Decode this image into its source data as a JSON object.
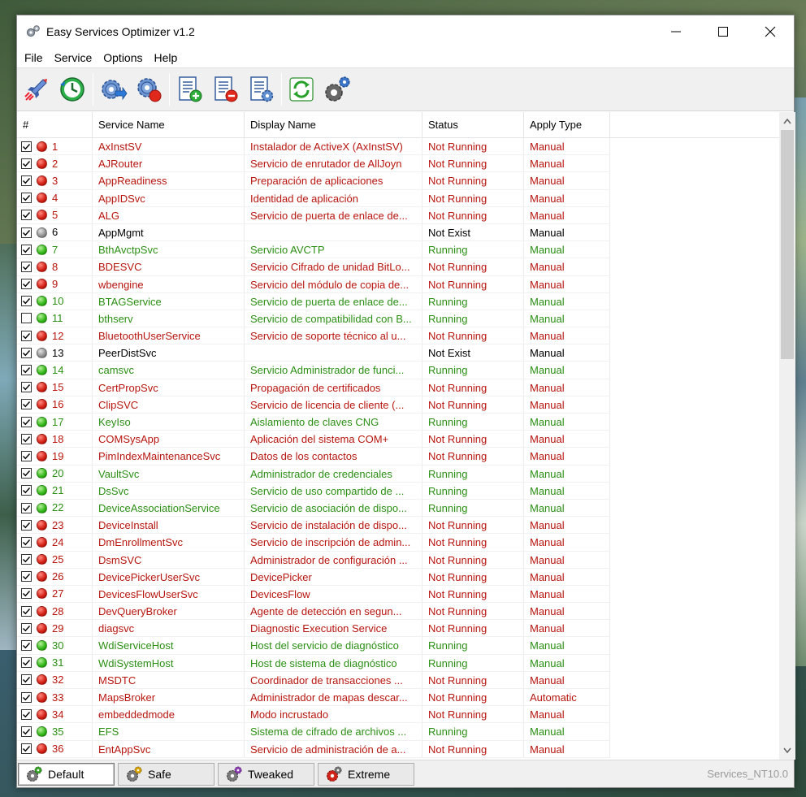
{
  "window": {
    "title": "Easy Services Optimizer v1.2"
  },
  "menu": [
    "File",
    "Service",
    "Options",
    "Help"
  ],
  "toolbar": [
    {
      "icon": "rocket-optimize-icon"
    },
    {
      "icon": "clock-restore-icon"
    },
    {
      "icon": "gear-arrow-icon"
    },
    {
      "icon": "gear-stop-icon"
    },
    {
      "icon": "list-add-icon"
    },
    {
      "icon": "list-remove-icon"
    },
    {
      "icon": "list-settings-icon"
    },
    {
      "icon": "refresh-icon"
    },
    {
      "icon": "gears-icon"
    }
  ],
  "table": {
    "headers": {
      "num": "#",
      "service": "Service Name",
      "display": "Display Name",
      "status": "Status",
      "type": "Apply Type"
    },
    "rows": [
      {
        "num": "1",
        "checked": true,
        "state": "red",
        "service": "AxInstSV",
        "display": "Instalador de ActiveX (AxInstSV)",
        "status": "Not Running",
        "type": "Manual"
      },
      {
        "num": "2",
        "checked": true,
        "state": "red",
        "service": "AJRouter",
        "display": "Servicio de enrutador de AllJoyn",
        "status": "Not Running",
        "type": "Manual"
      },
      {
        "num": "3",
        "checked": true,
        "state": "red",
        "service": "AppReadiness",
        "display": "Preparación de aplicaciones",
        "status": "Not Running",
        "type": "Manual"
      },
      {
        "num": "4",
        "checked": true,
        "state": "red",
        "service": "AppIDSvc",
        "display": "Identidad de aplicación",
        "status": "Not Running",
        "type": "Manual"
      },
      {
        "num": "5",
        "checked": true,
        "state": "red",
        "service": "ALG",
        "display": "Servicio de puerta de enlace de...",
        "status": "Not Running",
        "type": "Manual"
      },
      {
        "num": "6",
        "checked": true,
        "state": "gray",
        "service": "AppMgmt",
        "display": "",
        "status": "Not Exist",
        "type": "Manual"
      },
      {
        "num": "7",
        "checked": true,
        "state": "green",
        "service": "BthAvctpSvc",
        "display": "Servicio AVCTP",
        "status": "Running",
        "type": "Manual"
      },
      {
        "num": "8",
        "checked": true,
        "state": "red",
        "service": "BDESVC",
        "display": "Servicio Cifrado de unidad BitLo...",
        "status": "Not Running",
        "type": "Manual"
      },
      {
        "num": "9",
        "checked": true,
        "state": "red",
        "service": "wbengine",
        "display": "Servicio del módulo de copia de...",
        "status": "Not Running",
        "type": "Manual"
      },
      {
        "num": "10",
        "checked": true,
        "state": "green",
        "service": "BTAGService",
        "display": "Servicio de puerta de enlace de...",
        "status": "Running",
        "type": "Manual"
      },
      {
        "num": "11",
        "checked": false,
        "state": "green",
        "service": "bthserv",
        "display": "Servicio de compatibilidad con B...",
        "status": "Running",
        "type": "Manual"
      },
      {
        "num": "12",
        "checked": true,
        "state": "red",
        "service": "BluetoothUserService",
        "display": "Servicio de soporte técnico al u...",
        "status": "Not Running",
        "type": "Manual"
      },
      {
        "num": "13",
        "checked": true,
        "state": "gray",
        "service": "PeerDistSvc",
        "display": "",
        "status": "Not Exist",
        "type": "Manual"
      },
      {
        "num": "14",
        "checked": true,
        "state": "green",
        "service": "camsvc",
        "display": "Servicio Administrador de funci...",
        "status": "Running",
        "type": "Manual"
      },
      {
        "num": "15",
        "checked": true,
        "state": "red",
        "service": "CertPropSvc",
        "display": "Propagación de certificados",
        "status": "Not Running",
        "type": "Manual"
      },
      {
        "num": "16",
        "checked": true,
        "state": "red",
        "service": "ClipSVC",
        "display": "Servicio de licencia de cliente (...",
        "status": "Not Running",
        "type": "Manual"
      },
      {
        "num": "17",
        "checked": true,
        "state": "green",
        "service": "KeyIso",
        "display": "Aislamiento de claves CNG",
        "status": "Running",
        "type": "Manual"
      },
      {
        "num": "18",
        "checked": true,
        "state": "red",
        "service": "COMSysApp",
        "display": "Aplicación del sistema COM+",
        "status": "Not Running",
        "type": "Manual"
      },
      {
        "num": "19",
        "checked": true,
        "state": "red",
        "service": "PimIndexMaintenanceSvc",
        "display": "Datos de los contactos",
        "status": "Not Running",
        "type": "Manual"
      },
      {
        "num": "20",
        "checked": true,
        "state": "green",
        "service": "VaultSvc",
        "display": "Administrador de credenciales",
        "status": "Running",
        "type": "Manual"
      },
      {
        "num": "21",
        "checked": true,
        "state": "green",
        "service": "DsSvc",
        "display": "Servicio de uso compartido de ...",
        "status": "Running",
        "type": "Manual"
      },
      {
        "num": "22",
        "checked": true,
        "state": "green",
        "service": "DeviceAssociationService",
        "display": "Servicio de asociación de dispo...",
        "status": "Running",
        "type": "Manual"
      },
      {
        "num": "23",
        "checked": true,
        "state": "red",
        "service": "DeviceInstall",
        "display": "Servicio de instalación de dispo...",
        "status": "Not Running",
        "type": "Manual"
      },
      {
        "num": "24",
        "checked": true,
        "state": "red",
        "service": "DmEnrollmentSvc",
        "display": "Servicio de inscripción de admin...",
        "status": "Not Running",
        "type": "Manual"
      },
      {
        "num": "25",
        "checked": true,
        "state": "red",
        "service": "DsmSVC",
        "display": "Administrador de configuración ...",
        "status": "Not Running",
        "type": "Manual"
      },
      {
        "num": "26",
        "checked": true,
        "state": "red",
        "service": "DevicePickerUserSvc",
        "display": "DevicePicker",
        "status": "Not Running",
        "type": "Manual"
      },
      {
        "num": "27",
        "checked": true,
        "state": "red",
        "service": "DevicesFlowUserSvc",
        "display": "DevicesFlow",
        "status": "Not Running",
        "type": "Manual"
      },
      {
        "num": "28",
        "checked": true,
        "state": "red",
        "service": "DevQueryBroker",
        "display": "Agente de detección en segun...",
        "status": "Not Running",
        "type": "Manual"
      },
      {
        "num": "29",
        "checked": true,
        "state": "red",
        "service": "diagsvc",
        "display": "Diagnostic Execution Service",
        "status": "Not Running",
        "type": "Manual"
      },
      {
        "num": "30",
        "checked": true,
        "state": "green",
        "service": "WdiServiceHost",
        "display": "Host del servicio de diagnóstico",
        "status": "Running",
        "type": "Manual"
      },
      {
        "num": "31",
        "checked": true,
        "state": "green",
        "service": "WdiSystemHost",
        "display": "Host de sistema de diagnóstico",
        "status": "Running",
        "type": "Manual"
      },
      {
        "num": "32",
        "checked": true,
        "state": "red",
        "service": "MSDTC",
        "display": "Coordinador de transacciones ...",
        "status": "Not Running",
        "type": "Manual"
      },
      {
        "num": "33",
        "checked": true,
        "state": "red",
        "service": "MapsBroker",
        "display": "Administrador de mapas descar...",
        "status": "Not Running",
        "type": "Automatic"
      },
      {
        "num": "34",
        "checked": true,
        "state": "red",
        "service": "embeddedmode",
        "display": "Modo incrustado",
        "status": "Not Running",
        "type": "Manual"
      },
      {
        "num": "35",
        "checked": true,
        "state": "green",
        "service": "EFS",
        "display": "Sistema de cifrado de archivos ...",
        "status": "Running",
        "type": "Manual"
      },
      {
        "num": "36",
        "checked": true,
        "state": "red",
        "service": "EntAppSvc",
        "display": "Servicio de administración de a...",
        "status": "Not Running",
        "type": "Manual"
      }
    ]
  },
  "presets": [
    {
      "label": "Default",
      "icon": "gear-green-icon",
      "active": true,
      "color": "#3aa52a"
    },
    {
      "label": "Safe",
      "icon": "gear-yellow-icon",
      "active": false,
      "color": "#d9a400"
    },
    {
      "label": "Tweaked",
      "icon": "gear-purple-icon",
      "active": false,
      "color": "#8e3fb5"
    },
    {
      "label": "Extreme",
      "icon": "gear-red-icon",
      "active": false,
      "color": "#d0241a"
    }
  ],
  "status_text": "Services_NT10.0",
  "colors": {
    "running": "#2b8f14",
    "not_running": "#b8150f",
    "not_exist": "#000000"
  }
}
